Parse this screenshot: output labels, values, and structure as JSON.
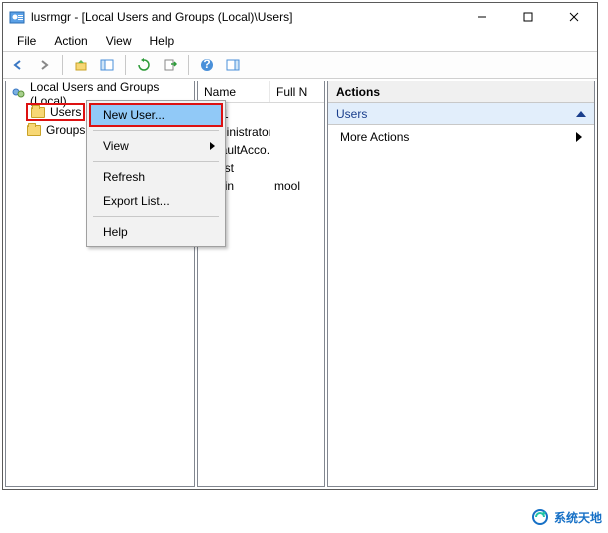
{
  "window": {
    "title": "lusrmgr - [Local Users and Groups (Local)\\Users]"
  },
  "menubar": [
    "File",
    "Action",
    "View",
    "Help"
  ],
  "tree": {
    "root": "Local Users and Groups (Local)",
    "items": [
      "Users",
      "Groups"
    ]
  },
  "list": {
    "columns": {
      "name": "Name",
      "full": "Full N"
    },
    "rows": [
      {
        "name": "5001",
        "full": ""
      },
      {
        "name": "Administrator",
        "full": ""
      },
      {
        "name": "DefaultAcco...",
        "full": ""
      },
      {
        "name": "Guest",
        "full": ""
      },
      {
        "name": "noolin",
        "full": "mool"
      }
    ]
  },
  "actions": {
    "header": "Actions",
    "section": "Users",
    "more": "More Actions"
  },
  "context_menu": {
    "items": [
      {
        "label": "New User...",
        "hover": true
      },
      {
        "sep": true
      },
      {
        "label": "View",
        "submenu": true
      },
      {
        "sep": true
      },
      {
        "label": "Refresh"
      },
      {
        "label": "Export List..."
      },
      {
        "sep": true
      },
      {
        "label": "Help"
      }
    ]
  },
  "watermark": "系统天地"
}
